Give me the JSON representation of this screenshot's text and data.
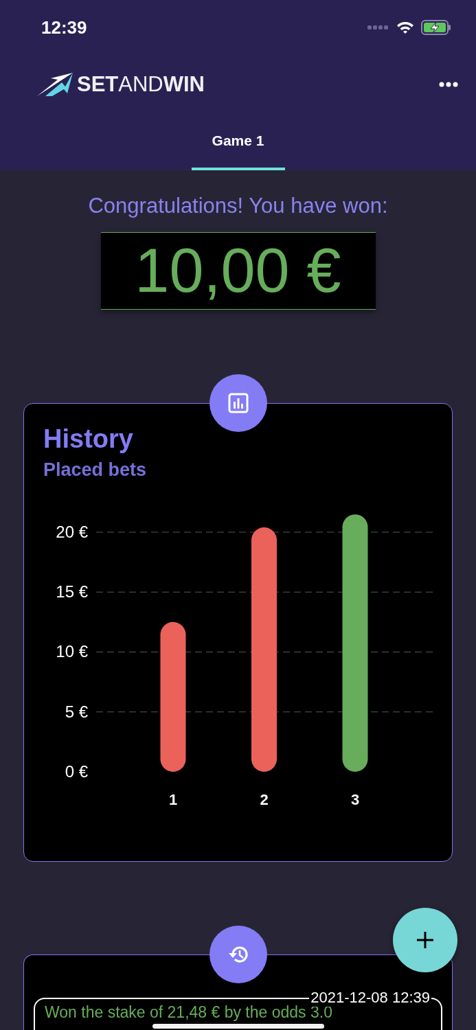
{
  "status_bar": {
    "time": "12:39"
  },
  "app_bar": {
    "logo": "**SET**AND**WIN**"
  },
  "tabs": [
    {
      "label": "Game 1",
      "selected": true
    }
  ],
  "result": {
    "message": "Congratulations! You have won:",
    "amount": "10,00 €"
  },
  "history_card": {
    "title": "History",
    "subtitle": "Placed bets",
    "chart_data": {
      "type": "bar",
      "ylim": [
        0,
        21.5
      ],
      "grid": true,
      "categories": [
        "1",
        "2",
        "3"
      ],
      "values": [
        12.5,
        20.4,
        21.48
      ],
      "colors": [
        "#eb625b",
        "#eb625b",
        "#67ad5b"
      ],
      "yticks": [
        {
          "value": 0,
          "label": "0 €"
        },
        {
          "value": 5,
          "label": "5 €"
        },
        {
          "value": 10,
          "label": "10 €"
        },
        {
          "value": 15,
          "label": "15 €"
        },
        {
          "value": 20,
          "label": "20 €"
        }
      ]
    }
  },
  "bets_card": {
    "entries": [
      {
        "date": "2021-12-08 12:39",
        "text": "Won the stake of 21,48 € by the odds 3.0"
      }
    ]
  }
}
